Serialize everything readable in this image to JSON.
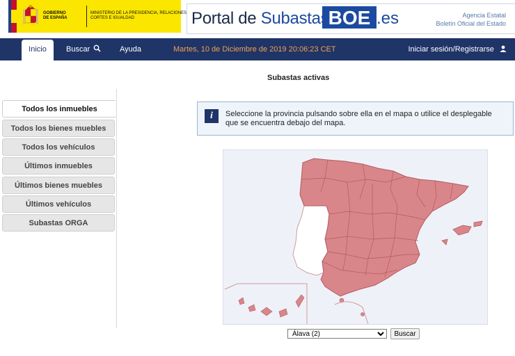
{
  "header": {
    "gov_name": "GOBIERNO DE ESPAÑA",
    "ministry": "MINISTERIO DE LA PRESIDENCIA, RELACIONES CON LAS CORTES E IGUALDAD",
    "portal_prefix": "Portal de ",
    "portal_subastas": "Subastas.",
    "boe": "BOE",
    "portal_suffix": ".es",
    "agency_line1": "Agencia Estatal",
    "agency_line2": "Boletín Oficial del Estado"
  },
  "nav": {
    "inicio": "Inicio",
    "buscar": "Buscar",
    "ayuda": "Ayuda",
    "datetime": "Martes, 10 de Diciembre de 2019   20:06:23   CET",
    "login": "Iniciar sesión/Registrarse"
  },
  "main": {
    "heading": "Subastas activas",
    "info": "Seleccione la provincia pulsando sobre ella en el mapa o utilice el desplegable que se encuentra debajo del mapa.",
    "info_icon": "i",
    "select_value": "Álava (2)",
    "search_button": "Buscar"
  },
  "sidebar": {
    "items": [
      {
        "label": "Todos los inmuebles"
      },
      {
        "label": "Todos los bienes muebles"
      },
      {
        "label": "Todos los vehículos"
      },
      {
        "label": "Últimos inmuebles"
      },
      {
        "label": "Últimos bienes muebles"
      },
      {
        "label": "Últimos vehículos"
      },
      {
        "label": "Subastas ORGA"
      }
    ]
  },
  "colors": {
    "nav_bg": "#1f3467",
    "gov_yellow": "#fbe600",
    "datetime": "#f0a050",
    "map_spain": "#d9868a",
    "map_border": "#b35a62",
    "map_portugal": "#ffffff"
  },
  "icons": {
    "search": "magnifier-icon",
    "user": "user-icon",
    "info": "info-icon"
  }
}
